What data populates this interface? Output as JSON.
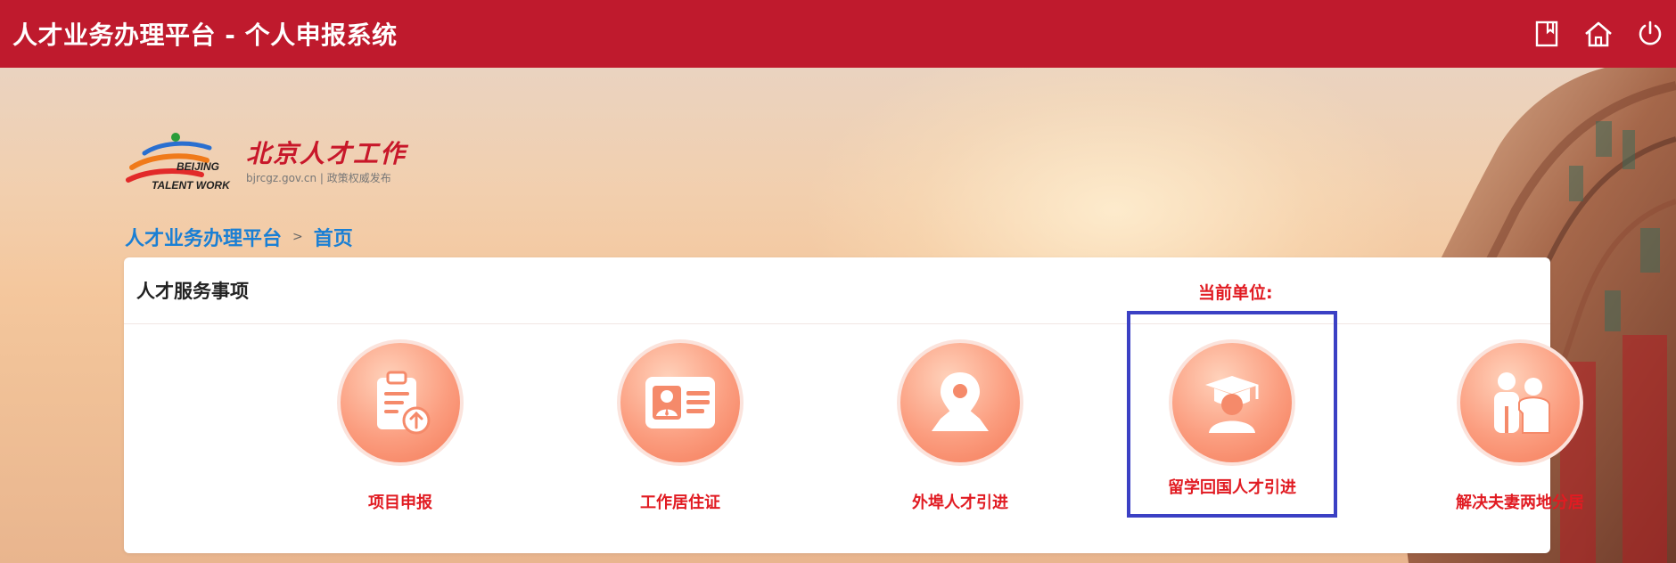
{
  "app": {
    "title": "人才业务办理平台 - 个人申报系统"
  },
  "top_icons": [
    {
      "name": "bookmark-icon"
    },
    {
      "name": "home-icon"
    },
    {
      "name": "power-icon"
    }
  ],
  "logo": {
    "brand_line1": "BEIJING",
    "brand_line2": "TALENT WORK",
    "name_cn": "北京人才工作",
    "url": "bjrcgz.gov.cn",
    "tagline": "政策权威发布"
  },
  "breadcrumb": {
    "items": [
      "人才业务办理平台",
      "首页"
    ],
    "separator": ">"
  },
  "panel": {
    "title": "人才服务事项",
    "current_unit_label": "当前单位:"
  },
  "services": [
    {
      "label": "项目申报",
      "icon": "clipboard-upload-icon"
    },
    {
      "label": "工作居住证",
      "icon": "id-card-icon"
    },
    {
      "label": "外埠人才引进",
      "icon": "map-pin-icon"
    },
    {
      "label": "留学回国人才引进",
      "icon": "graduate-icon",
      "selected": true
    },
    {
      "label": "解决夫妻两地分居",
      "icon": "couple-icon"
    }
  ],
  "colors": {
    "header": "#bf1a2d",
    "link": "#1a7fd4",
    "accent_red": "#e11b22",
    "selection": "#3b40c4"
  }
}
